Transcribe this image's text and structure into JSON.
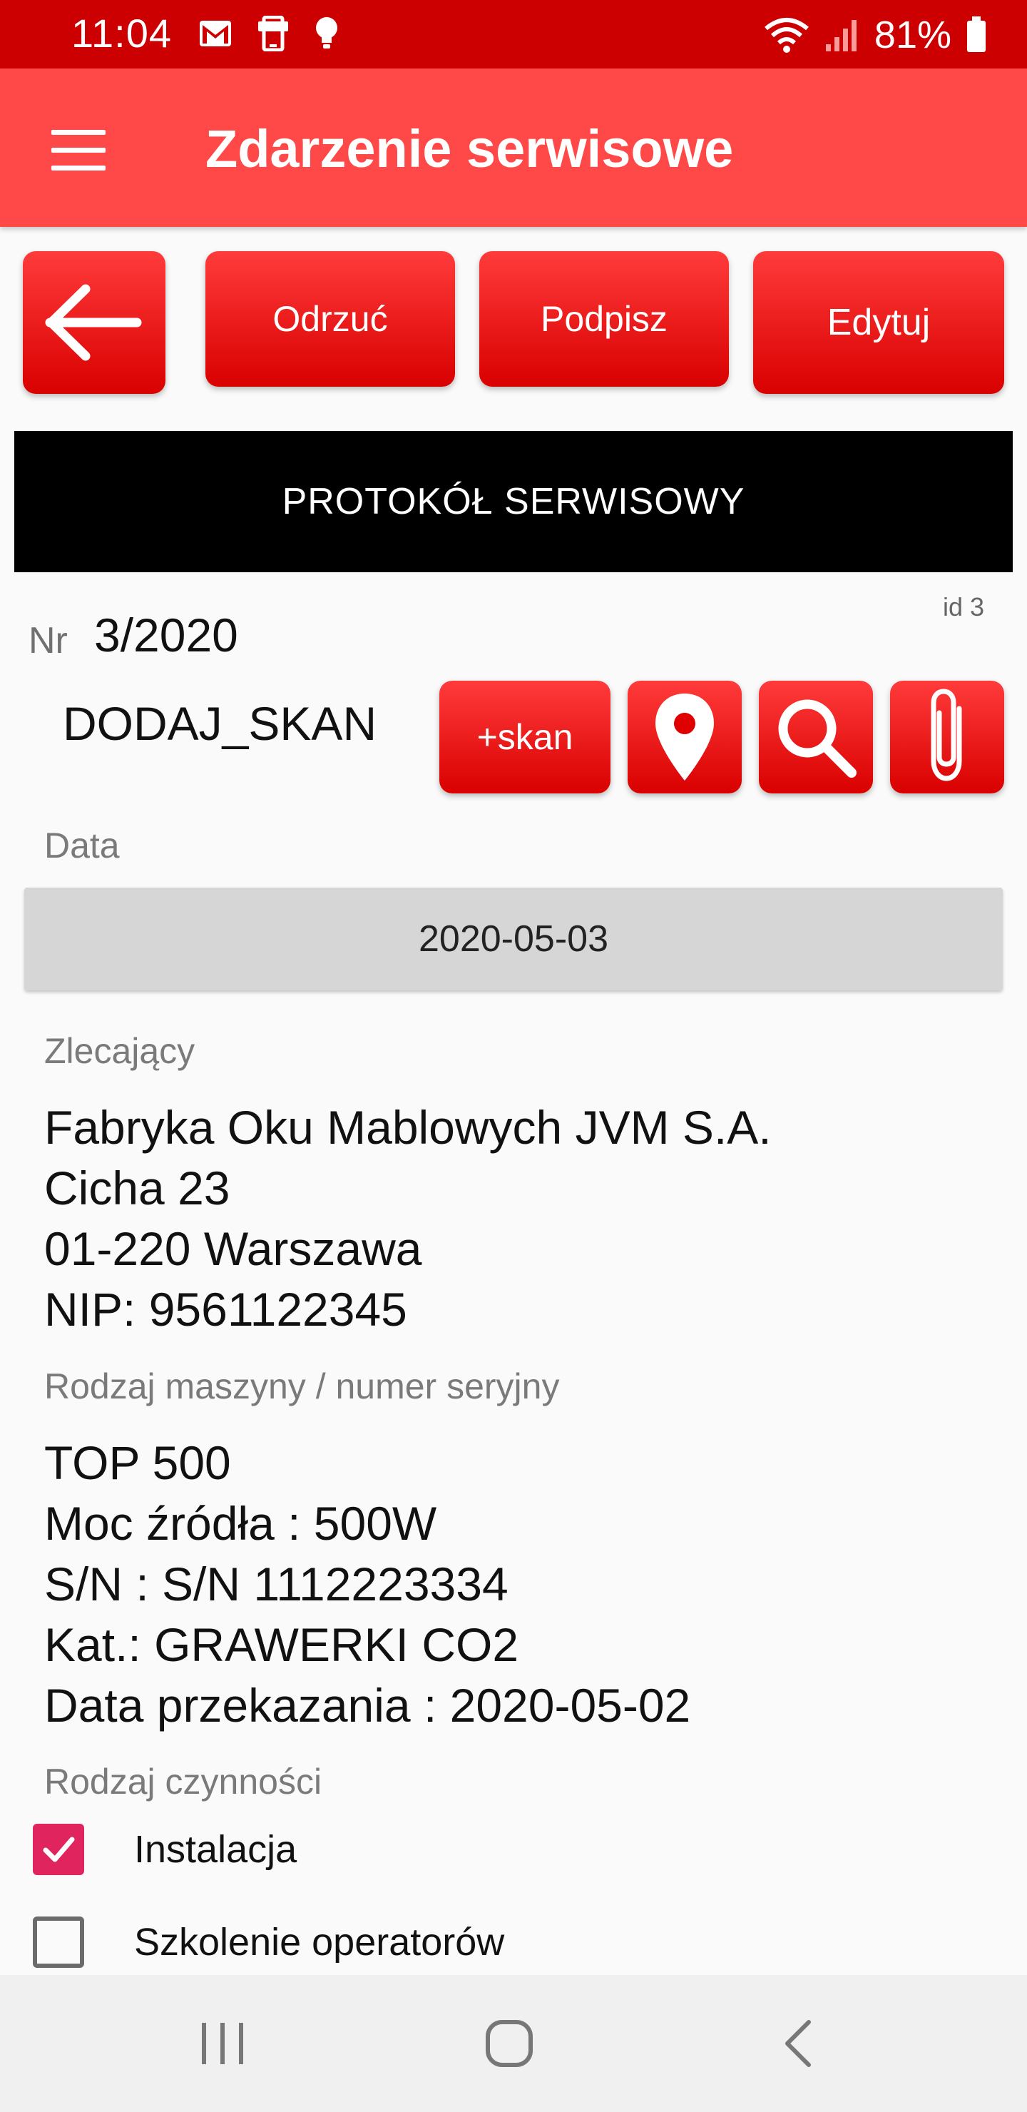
{
  "status_bar": {
    "time": "11:04",
    "battery": "81%",
    "icons": [
      "gmail-icon",
      "phone-icon",
      "bulb-icon",
      "wifi-icon",
      "signal-icon",
      "battery-icon"
    ]
  },
  "app_bar": {
    "title": "Zdarzenie serwisowe",
    "color": "#ff4848"
  },
  "toolbar": {
    "reject_label": "Odrzuć",
    "sign_label": "Podpisz",
    "edit_label": "Edytuj"
  },
  "section_title": "PROTOKÓŁ SERWISOWY",
  "record": {
    "id_label": "id 3",
    "nr_label": "Nr",
    "nr_value": "3/2020",
    "scan_label": "DODAJ_SKAN",
    "scan_button": "+skan"
  },
  "date": {
    "label": "Data",
    "value": "2020-05-03"
  },
  "ordering": {
    "label": "Zlecający",
    "lines": [
      "Fabryka Oku Mablowych JVM S.A.",
      "Cicha 23",
      "01-220 Warszawa",
      "NIP: 9561122345"
    ]
  },
  "machine": {
    "label": "Rodzaj maszyny / numer seryjny",
    "lines": [
      "TOP 500",
      "Moc źródła : 500W",
      "S/N : S/N 1112223334",
      "Kat.: GRAWERKI CO2",
      "Data przekazania : 2020-05-02"
    ]
  },
  "activities": {
    "label": "Rodzaj czynności",
    "items": [
      {
        "label": "Instalacja",
        "checked": true
      },
      {
        "label": "Szkolenie operatorów",
        "checked": false
      }
    ]
  },
  "colors": {
    "status_bar": "#cc0000",
    "accent": "#ff4848",
    "checkbox": "#e0245e"
  }
}
